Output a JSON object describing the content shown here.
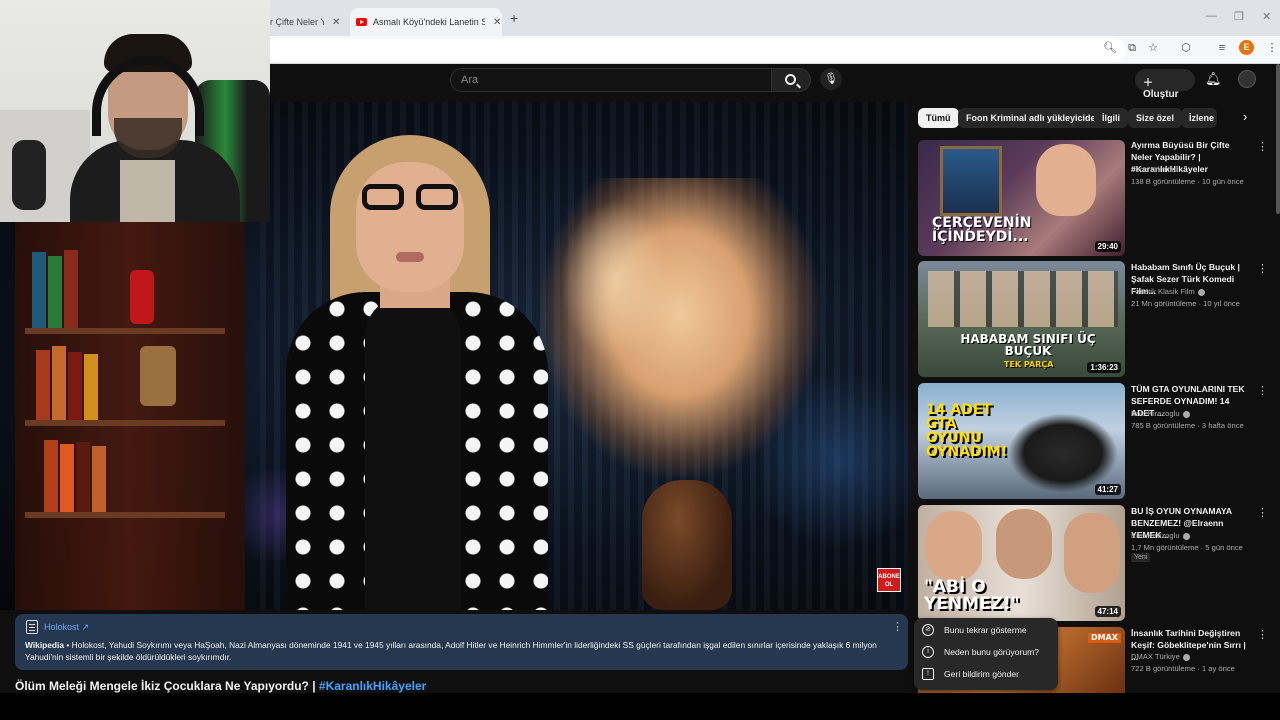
{
  "browser": {
    "tabs": [
      {
        "label": "ir Çifte Neler Y"
      },
      {
        "label": "Asmalı Köyü'ndeki Lanetin Sırrı"
      }
    ],
    "new_tab": "+",
    "profile_initial": "E"
  },
  "header": {
    "search_placeholder": "Ara",
    "create_label": "Oluştur"
  },
  "video": {
    "overlay_badge": "ABONE OL",
    "info": {
      "title": "Holokost ↗",
      "source": "Wikipedia",
      "text": " • Holokost, Yahudi Soykırımı veya HaŞoah, Nazi Almanyası döneminde 1941 ve 1945 yılları arasında, Adolf Hitler ve Heinrich Himmler'in liderliğindeki SS güçleri tarafından işgal edilen sınırlar içerisinde yaklaşık 6 milyon Yahudi'nin sistemli bir şekilde öldürüldükleri soykırımdır."
    },
    "title": "Ölüm Meleği Mengele İkiz Çocuklara Ne Yapıyordu? | ",
    "hashtag": "#KaranlıkHikâyeler"
  },
  "chips": [
    "Tümü",
    "Foon Kriminal adlı yükleyiciden",
    "İlgili",
    "Size özel",
    "İzlene"
  ],
  "recommendations": [
    {
      "title": "Ayırma Büyüsü Bir Çifte Neler Yapabilir? | #KaranlıkHikâyeler",
      "channel": "Foon Kriminal",
      "verified": false,
      "meta": "138 B görüntüleme · 10 gün önce",
      "duration": "29:40",
      "thumb_text": "ÇERÇEVENİN İÇİNDEYDİ..."
    },
    {
      "title": "Hababam Sınıfı Üç Buçuk | Şafak Sezer Türk Komedi Film...",
      "channel": "Fanatik Klasik Film",
      "verified": true,
      "meta": "21 Mn görüntüleme · 10 yıl önce",
      "duration": "1:36:23",
      "thumb_text": "HABABAM SINIFI ÜÇ BUÇUK",
      "thumb_sub": "TEK PARÇA"
    },
    {
      "title": "TÜM GTA OYUNLARINI TEK SEFERDE OYNADIM! 14 ADET ...",
      "channel": "Enis Kirazoglu",
      "verified": true,
      "meta": "785 B görüntüleme · 3 hafta önce",
      "duration": "41:27",
      "thumb_text": "14 ADET GTA OYUNU OYNADIM!"
    },
    {
      "title": "BU İŞ OYUN OYNAMAYA BENZEMEZ! @Elraenn YEMEK...",
      "channel": "Enis Kirazoglu",
      "verified": true,
      "meta": "1,7 Mn görüntüleme · 5 gün önce",
      "duration": "47:14",
      "badge": "Yeni",
      "thumb_text": "\"ABİ O YENMEZ!\""
    },
    {
      "title": "İnsanlık Tarihini Değiştiren Keşif: Göbeklitepe'nin Sırrı | ...",
      "channel": "DMAX Türkiye",
      "verified": true,
      "meta": "722 B görüntüleme · 1 ay önce",
      "thumb_text": "DMAX"
    }
  ],
  "context_menu": [
    {
      "label": "Bunu tekrar gösterme",
      "icon": "block-icon"
    },
    {
      "label": "Neden bunu görüyorum?",
      "icon": "info-icon"
    },
    {
      "label": "Geri bildirim gönder",
      "icon": "feedback-icon"
    }
  ],
  "colors": {
    "accent": "#3ea6ff",
    "brand": "#ff0000",
    "background": "#0f0f0f"
  }
}
